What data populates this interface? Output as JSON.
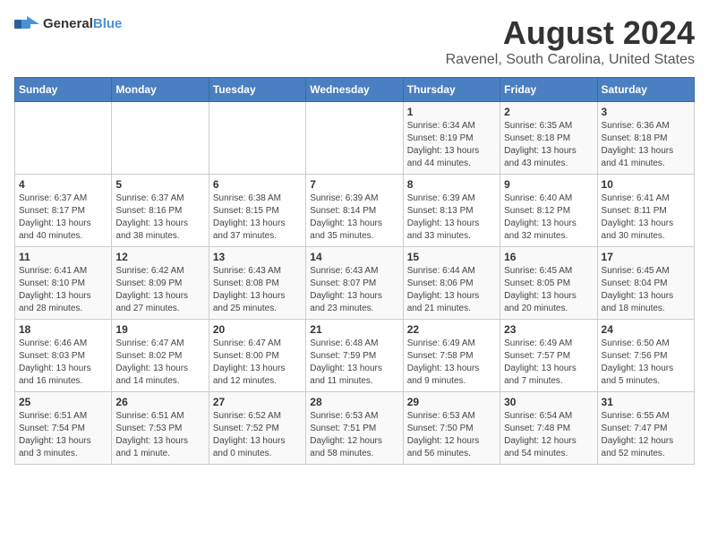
{
  "logo": {
    "text_general": "General",
    "text_blue": "Blue"
  },
  "header": {
    "title": "August 2024",
    "subtitle": "Ravenel, South Carolina, United States"
  },
  "weekdays": [
    "Sunday",
    "Monday",
    "Tuesday",
    "Wednesday",
    "Thursday",
    "Friday",
    "Saturday"
  ],
  "weeks": [
    [
      {
        "day": "",
        "info": ""
      },
      {
        "day": "",
        "info": ""
      },
      {
        "day": "",
        "info": ""
      },
      {
        "day": "",
        "info": ""
      },
      {
        "day": "1",
        "info": "Sunrise: 6:34 AM\nSunset: 8:19 PM\nDaylight: 13 hours\nand 44 minutes."
      },
      {
        "day": "2",
        "info": "Sunrise: 6:35 AM\nSunset: 8:18 PM\nDaylight: 13 hours\nand 43 minutes."
      },
      {
        "day": "3",
        "info": "Sunrise: 6:36 AM\nSunset: 8:18 PM\nDaylight: 13 hours\nand 41 minutes."
      }
    ],
    [
      {
        "day": "4",
        "info": "Sunrise: 6:37 AM\nSunset: 8:17 PM\nDaylight: 13 hours\nand 40 minutes."
      },
      {
        "day": "5",
        "info": "Sunrise: 6:37 AM\nSunset: 8:16 PM\nDaylight: 13 hours\nand 38 minutes."
      },
      {
        "day": "6",
        "info": "Sunrise: 6:38 AM\nSunset: 8:15 PM\nDaylight: 13 hours\nand 37 minutes."
      },
      {
        "day": "7",
        "info": "Sunrise: 6:39 AM\nSunset: 8:14 PM\nDaylight: 13 hours\nand 35 minutes."
      },
      {
        "day": "8",
        "info": "Sunrise: 6:39 AM\nSunset: 8:13 PM\nDaylight: 13 hours\nand 33 minutes."
      },
      {
        "day": "9",
        "info": "Sunrise: 6:40 AM\nSunset: 8:12 PM\nDaylight: 13 hours\nand 32 minutes."
      },
      {
        "day": "10",
        "info": "Sunrise: 6:41 AM\nSunset: 8:11 PM\nDaylight: 13 hours\nand 30 minutes."
      }
    ],
    [
      {
        "day": "11",
        "info": "Sunrise: 6:41 AM\nSunset: 8:10 PM\nDaylight: 13 hours\nand 28 minutes."
      },
      {
        "day": "12",
        "info": "Sunrise: 6:42 AM\nSunset: 8:09 PM\nDaylight: 13 hours\nand 27 minutes."
      },
      {
        "day": "13",
        "info": "Sunrise: 6:43 AM\nSunset: 8:08 PM\nDaylight: 13 hours\nand 25 minutes."
      },
      {
        "day": "14",
        "info": "Sunrise: 6:43 AM\nSunset: 8:07 PM\nDaylight: 13 hours\nand 23 minutes."
      },
      {
        "day": "15",
        "info": "Sunrise: 6:44 AM\nSunset: 8:06 PM\nDaylight: 13 hours\nand 21 minutes."
      },
      {
        "day": "16",
        "info": "Sunrise: 6:45 AM\nSunset: 8:05 PM\nDaylight: 13 hours\nand 20 minutes."
      },
      {
        "day": "17",
        "info": "Sunrise: 6:45 AM\nSunset: 8:04 PM\nDaylight: 13 hours\nand 18 minutes."
      }
    ],
    [
      {
        "day": "18",
        "info": "Sunrise: 6:46 AM\nSunset: 8:03 PM\nDaylight: 13 hours\nand 16 minutes."
      },
      {
        "day": "19",
        "info": "Sunrise: 6:47 AM\nSunset: 8:02 PM\nDaylight: 13 hours\nand 14 minutes."
      },
      {
        "day": "20",
        "info": "Sunrise: 6:47 AM\nSunset: 8:00 PM\nDaylight: 13 hours\nand 12 minutes."
      },
      {
        "day": "21",
        "info": "Sunrise: 6:48 AM\nSunset: 7:59 PM\nDaylight: 13 hours\nand 11 minutes."
      },
      {
        "day": "22",
        "info": "Sunrise: 6:49 AM\nSunset: 7:58 PM\nDaylight: 13 hours\nand 9 minutes."
      },
      {
        "day": "23",
        "info": "Sunrise: 6:49 AM\nSunset: 7:57 PM\nDaylight: 13 hours\nand 7 minutes."
      },
      {
        "day": "24",
        "info": "Sunrise: 6:50 AM\nSunset: 7:56 PM\nDaylight: 13 hours\nand 5 minutes."
      }
    ],
    [
      {
        "day": "25",
        "info": "Sunrise: 6:51 AM\nSunset: 7:54 PM\nDaylight: 13 hours\nand 3 minutes."
      },
      {
        "day": "26",
        "info": "Sunrise: 6:51 AM\nSunset: 7:53 PM\nDaylight: 13 hours\nand 1 minute."
      },
      {
        "day": "27",
        "info": "Sunrise: 6:52 AM\nSunset: 7:52 PM\nDaylight: 13 hours\nand 0 minutes."
      },
      {
        "day": "28",
        "info": "Sunrise: 6:53 AM\nSunset: 7:51 PM\nDaylight: 12 hours\nand 58 minutes."
      },
      {
        "day": "29",
        "info": "Sunrise: 6:53 AM\nSunset: 7:50 PM\nDaylight: 12 hours\nand 56 minutes."
      },
      {
        "day": "30",
        "info": "Sunrise: 6:54 AM\nSunset: 7:48 PM\nDaylight: 12 hours\nand 54 minutes."
      },
      {
        "day": "31",
        "info": "Sunrise: 6:55 AM\nSunset: 7:47 PM\nDaylight: 12 hours\nand 52 minutes."
      }
    ]
  ]
}
